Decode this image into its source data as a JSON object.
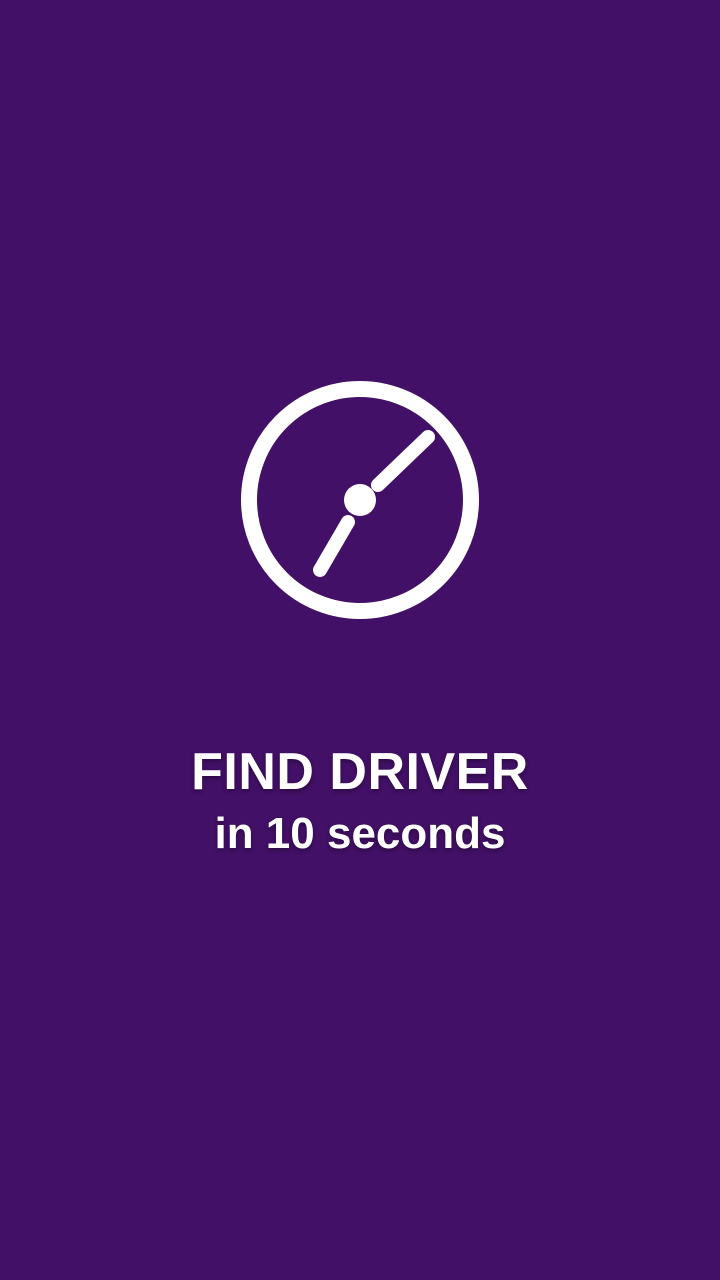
{
  "splash": {
    "icon": "clock-icon",
    "title": "FIND DRIVER",
    "subtitle": "in 10 seconds"
  },
  "colors": {
    "background": "#421066",
    "foreground": "#ffffff"
  }
}
